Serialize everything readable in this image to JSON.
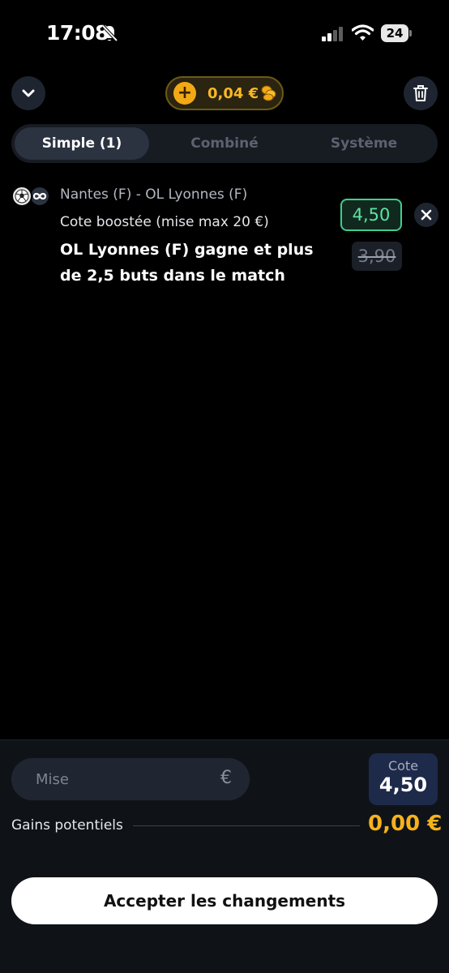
{
  "status_bar": {
    "time": "17:08",
    "battery": "24",
    "icons": [
      "bell-slash-icon",
      "signal-icon",
      "wifi-icon",
      "battery-icon"
    ]
  },
  "header": {
    "balance": "0,04 €",
    "icons": [
      "chevron-down-icon",
      "plus-coin-icon",
      "coins-icon",
      "trash-icon"
    ]
  },
  "tabs": [
    {
      "label": "Simple (1)",
      "active": true
    },
    {
      "label": "Combiné",
      "active": false
    },
    {
      "label": "Système",
      "active": false
    }
  ],
  "bet": {
    "match": "Nantes (F) - OL Lyonnes (F)",
    "boost_label": "Cote boostée (mise max 20 €)",
    "selection": "OL Lyonnes (F) gagne et plus de 2,5 buts dans le match",
    "odd_new": "4,50",
    "odd_old": "3,90",
    "icons": [
      "football-icon",
      "infinity-icon",
      "close-icon"
    ]
  },
  "slip": {
    "stake_placeholder": "Mise",
    "currency": "€",
    "cote_label": "Cote",
    "cote_value": "4,50",
    "gains_label": "Gains potentiels",
    "gains_value": "0,00 €",
    "accept_label": "Accepter les changements"
  },
  "colors": {
    "accent_gold": "#f6b21c",
    "odd_green": "#5de4a3",
    "background": "#000000"
  }
}
